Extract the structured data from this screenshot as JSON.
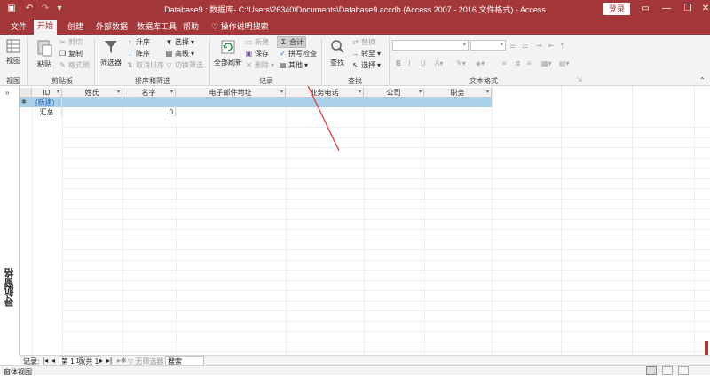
{
  "titlebar": {
    "title": "Database9 : 数据库- C:\\Users\\26340\\Documents\\Database9.accdb (Access 2007 - 2016 文件格式)  - Access",
    "login": "登录",
    "save_icon": "save-icon",
    "undo_icon": "undo-icon",
    "redo_icon": "redo-icon",
    "customize_icon": "customize-qat-icon"
  },
  "tabs": [
    {
      "label": "文件"
    },
    {
      "label": "开始"
    },
    {
      "label": "创建"
    },
    {
      "label": "外部数据"
    },
    {
      "label": "数据库工具"
    },
    {
      "label": "帮助"
    },
    {
      "label": "操作说明搜索"
    }
  ],
  "ribbon": {
    "view": {
      "label": "视图",
      "group": "视图"
    },
    "clipboard": {
      "paste": "粘贴",
      "cut": "剪切",
      "copy": "复制",
      "format_painter": "格式刷",
      "group": "剪贴板"
    },
    "sort_filter": {
      "filter": "筛选器",
      "ascending": "升序",
      "descending": "降序",
      "clear_sort": "取消排序",
      "selection": "选择",
      "advanced": "高级",
      "toggle_filter": "切换筛选",
      "group": "排序和筛选"
    },
    "records": {
      "refresh_all": "全部刷新",
      "new": "新建",
      "save": "保存",
      "delete": "删除",
      "totals": "合计",
      "spelling": "拼写检查",
      "more": "其他",
      "group": "记录"
    },
    "find": {
      "find": "查找",
      "replace": "替换",
      "goto": "转至",
      "select": "选择",
      "group": "查找"
    },
    "text_format": {
      "group": "文本格式",
      "bold": "B",
      "italic": "I",
      "underline": "U"
    }
  },
  "nav_pane": {
    "label": "导航窗格"
  },
  "table": {
    "columns": [
      {
        "label": "ID"
      },
      {
        "label": "姓氏"
      },
      {
        "label": "名字"
      },
      {
        "label": "电子邮件地址"
      },
      {
        "label": "业务电话"
      },
      {
        "label": "公司"
      },
      {
        "label": "职务"
      }
    ],
    "new_row_label": "(新建)",
    "total_label": "汇总",
    "total_value": "0"
  },
  "record_nav": {
    "label": "记录:",
    "position": "第 1 项(共 1",
    "no_filter": "无筛选器",
    "search": "搜索"
  },
  "status": {
    "view": "窗体视图"
  },
  "colors": {
    "accent": "#a4373a",
    "selection": "#abd0ea",
    "arrow": "#e0474a"
  }
}
